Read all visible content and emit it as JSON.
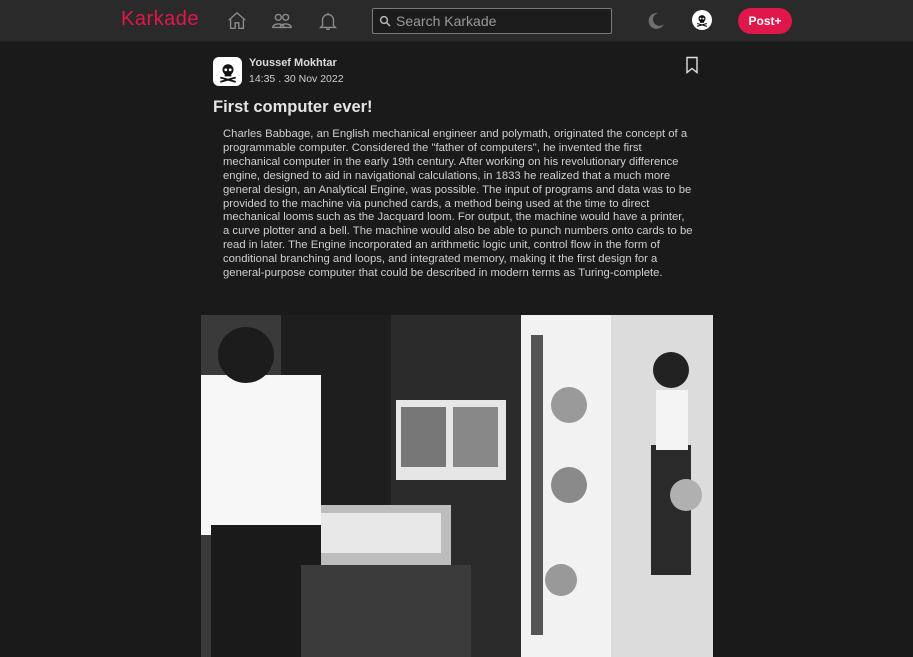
{
  "header": {
    "logo": "Karkade",
    "search_placeholder": "Search Karkade",
    "post_button": "Post+",
    "nav_icons": [
      "home-icon",
      "friends-icon",
      "bell-icon"
    ],
    "accent_color": "#e0174b"
  },
  "post": {
    "author": "Youssef Mokhtar",
    "timestamp": "14:35 . 30 Nov 2022",
    "title": "First computer ever!",
    "body": "Charles Babbage, an English mechanical engineer and polymath, originated the concept of a programmable computer. Considered the \"father of computers\", he invented the first mechanical computer in the early 19th century. After working on his revolutionary difference engine, designed to aid in navigational calculations, in 1833 he realized that a much more general design, an Analytical Engine, was possible. The input of programs and data was to be provided to the machine via punched cards, a method being used at the time to direct mechanical looms such as the Jacquard loom. For output, the machine would have a printer, a curve plotter and a bell. The machine would also be able to punch numbers onto cards to be read in later. The Engine incorporated an arithmetic logic unit, control flow in the form of conditional branching and loops, and integrated memory, making it the first design for a general-purpose computer that could be described in modern terms as Turing-complete."
  }
}
